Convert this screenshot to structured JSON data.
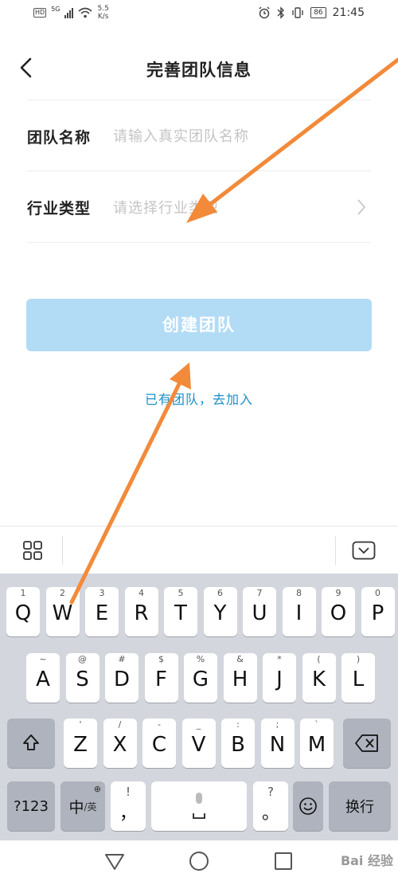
{
  "status_bar": {
    "hd": "HD",
    "network": "5G",
    "speed_value": "5.5",
    "speed_unit": "K/s",
    "battery": "86",
    "time": "21:45"
  },
  "header": {
    "title": "完善团队信息",
    "back_icon": "chevron-left-icon"
  },
  "form": {
    "team_name": {
      "label": "团队名称",
      "placeholder": "请输入真实团队名称",
      "value": ""
    },
    "industry": {
      "label": "行业类型",
      "placeholder": "请选择行业类型"
    }
  },
  "create_button": {
    "label": "创建团队",
    "color": "#b2dcf6"
  },
  "join_link": {
    "label": "已有团队，去加入",
    "color": "#1a8fc8"
  },
  "keyboard": {
    "row1": [
      {
        "hint": "1",
        "key": "Q"
      },
      {
        "hint": "2",
        "key": "W"
      },
      {
        "hint": "3",
        "key": "E"
      },
      {
        "hint": "4",
        "key": "R"
      },
      {
        "hint": "5",
        "key": "T"
      },
      {
        "hint": "6",
        "key": "Y"
      },
      {
        "hint": "7",
        "key": "U"
      },
      {
        "hint": "8",
        "key": "I"
      },
      {
        "hint": "9",
        "key": "O"
      },
      {
        "hint": "0",
        "key": "P"
      }
    ],
    "row2": [
      {
        "hint": "~",
        "key": "A"
      },
      {
        "hint": "@",
        "key": "S"
      },
      {
        "hint": "#",
        "key": "D"
      },
      {
        "hint": "$",
        "key": "F"
      },
      {
        "hint": "%",
        "key": "G"
      },
      {
        "hint": "&",
        "key": "H"
      },
      {
        "hint": "*",
        "key": "J"
      },
      {
        "hint": "(",
        "key": "K"
      },
      {
        "hint": ")",
        "key": "L"
      }
    ],
    "row3": [
      {
        "hint": "'",
        "key": "Z"
      },
      {
        "hint": "/",
        "key": "X"
      },
      {
        "hint": "-",
        "key": "C"
      },
      {
        "hint": "_",
        "key": "V"
      },
      {
        "hint": ":",
        "key": "B"
      },
      {
        "hint": ";",
        "key": "N"
      },
      {
        "hint": "`",
        "key": "M"
      }
    ],
    "numbers_key": "?123",
    "lang_key_main": "中",
    "lang_key_sub": "/英",
    "comma_hint": "!",
    "comma_key": "，",
    "period_hint": "?",
    "period_key": "。",
    "enter_key": "换行"
  },
  "watermark": "Bai 经验"
}
